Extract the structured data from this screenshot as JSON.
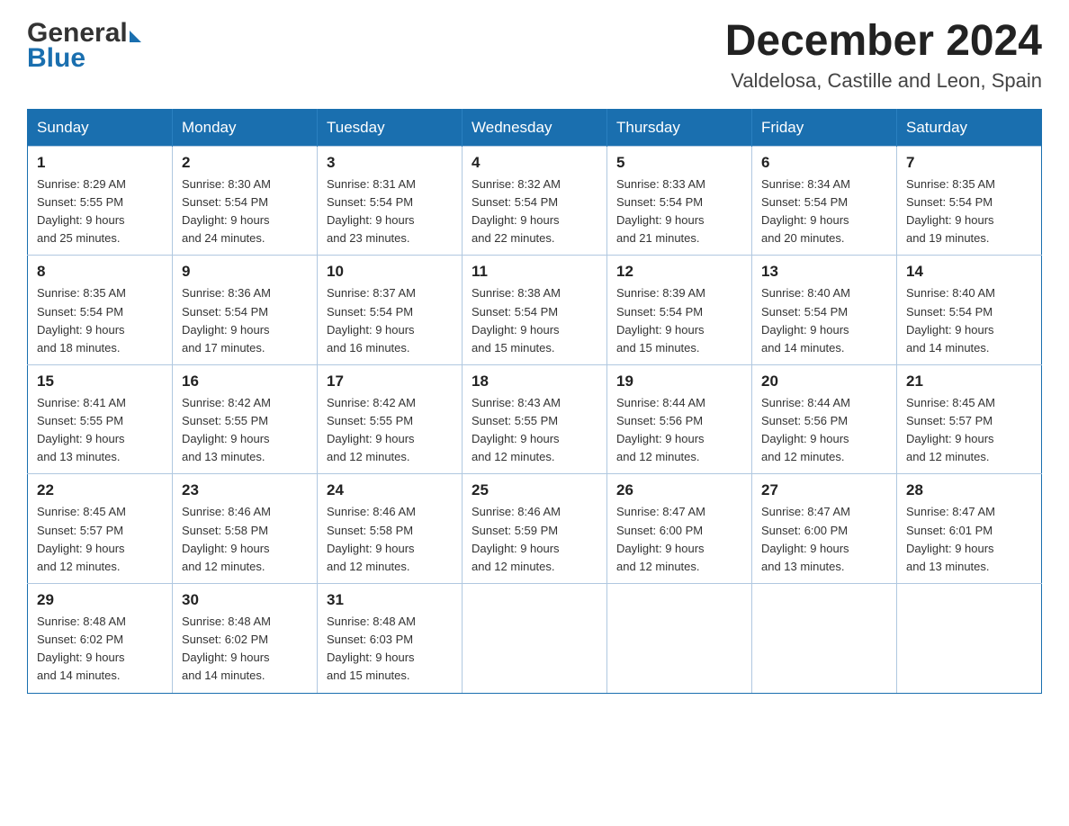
{
  "header": {
    "title": "December 2024",
    "subtitle": "Valdelosa, Castille and Leon, Spain",
    "logo_general": "General",
    "logo_blue": "Blue"
  },
  "days_of_week": [
    "Sunday",
    "Monday",
    "Tuesday",
    "Wednesday",
    "Thursday",
    "Friday",
    "Saturday"
  ],
  "weeks": [
    [
      {
        "day": "1",
        "sunrise": "8:29 AM",
        "sunset": "5:55 PM",
        "daylight": "9 hours and 25 minutes."
      },
      {
        "day": "2",
        "sunrise": "8:30 AM",
        "sunset": "5:54 PM",
        "daylight": "9 hours and 24 minutes."
      },
      {
        "day": "3",
        "sunrise": "8:31 AM",
        "sunset": "5:54 PM",
        "daylight": "9 hours and 23 minutes."
      },
      {
        "day": "4",
        "sunrise": "8:32 AM",
        "sunset": "5:54 PM",
        "daylight": "9 hours and 22 minutes."
      },
      {
        "day": "5",
        "sunrise": "8:33 AM",
        "sunset": "5:54 PM",
        "daylight": "9 hours and 21 minutes."
      },
      {
        "day": "6",
        "sunrise": "8:34 AM",
        "sunset": "5:54 PM",
        "daylight": "9 hours and 20 minutes."
      },
      {
        "day": "7",
        "sunrise": "8:35 AM",
        "sunset": "5:54 PM",
        "daylight": "9 hours and 19 minutes."
      }
    ],
    [
      {
        "day": "8",
        "sunrise": "8:35 AM",
        "sunset": "5:54 PM",
        "daylight": "9 hours and 18 minutes."
      },
      {
        "day": "9",
        "sunrise": "8:36 AM",
        "sunset": "5:54 PM",
        "daylight": "9 hours and 17 minutes."
      },
      {
        "day": "10",
        "sunrise": "8:37 AM",
        "sunset": "5:54 PM",
        "daylight": "9 hours and 16 minutes."
      },
      {
        "day": "11",
        "sunrise": "8:38 AM",
        "sunset": "5:54 PM",
        "daylight": "9 hours and 15 minutes."
      },
      {
        "day": "12",
        "sunrise": "8:39 AM",
        "sunset": "5:54 PM",
        "daylight": "9 hours and 15 minutes."
      },
      {
        "day": "13",
        "sunrise": "8:40 AM",
        "sunset": "5:54 PM",
        "daylight": "9 hours and 14 minutes."
      },
      {
        "day": "14",
        "sunrise": "8:40 AM",
        "sunset": "5:54 PM",
        "daylight": "9 hours and 14 minutes."
      }
    ],
    [
      {
        "day": "15",
        "sunrise": "8:41 AM",
        "sunset": "5:55 PM",
        "daylight": "9 hours and 13 minutes."
      },
      {
        "day": "16",
        "sunrise": "8:42 AM",
        "sunset": "5:55 PM",
        "daylight": "9 hours and 13 minutes."
      },
      {
        "day": "17",
        "sunrise": "8:42 AM",
        "sunset": "5:55 PM",
        "daylight": "9 hours and 12 minutes."
      },
      {
        "day": "18",
        "sunrise": "8:43 AM",
        "sunset": "5:55 PM",
        "daylight": "9 hours and 12 minutes."
      },
      {
        "day": "19",
        "sunrise": "8:44 AM",
        "sunset": "5:56 PM",
        "daylight": "9 hours and 12 minutes."
      },
      {
        "day": "20",
        "sunrise": "8:44 AM",
        "sunset": "5:56 PM",
        "daylight": "9 hours and 12 minutes."
      },
      {
        "day": "21",
        "sunrise": "8:45 AM",
        "sunset": "5:57 PM",
        "daylight": "9 hours and 12 minutes."
      }
    ],
    [
      {
        "day": "22",
        "sunrise": "8:45 AM",
        "sunset": "5:57 PM",
        "daylight": "9 hours and 12 minutes."
      },
      {
        "day": "23",
        "sunrise": "8:46 AM",
        "sunset": "5:58 PM",
        "daylight": "9 hours and 12 minutes."
      },
      {
        "day": "24",
        "sunrise": "8:46 AM",
        "sunset": "5:58 PM",
        "daylight": "9 hours and 12 minutes."
      },
      {
        "day": "25",
        "sunrise": "8:46 AM",
        "sunset": "5:59 PM",
        "daylight": "9 hours and 12 minutes."
      },
      {
        "day": "26",
        "sunrise": "8:47 AM",
        "sunset": "6:00 PM",
        "daylight": "9 hours and 12 minutes."
      },
      {
        "day": "27",
        "sunrise": "8:47 AM",
        "sunset": "6:00 PM",
        "daylight": "9 hours and 13 minutes."
      },
      {
        "day": "28",
        "sunrise": "8:47 AM",
        "sunset": "6:01 PM",
        "daylight": "9 hours and 13 minutes."
      }
    ],
    [
      {
        "day": "29",
        "sunrise": "8:48 AM",
        "sunset": "6:02 PM",
        "daylight": "9 hours and 14 minutes."
      },
      {
        "day": "30",
        "sunrise": "8:48 AM",
        "sunset": "6:02 PM",
        "daylight": "9 hours and 14 minutes."
      },
      {
        "day": "31",
        "sunrise": "8:48 AM",
        "sunset": "6:03 PM",
        "daylight": "9 hours and 15 minutes."
      },
      null,
      null,
      null,
      null
    ]
  ],
  "labels": {
    "sunrise": "Sunrise:",
    "sunset": "Sunset:",
    "daylight": "Daylight:"
  }
}
